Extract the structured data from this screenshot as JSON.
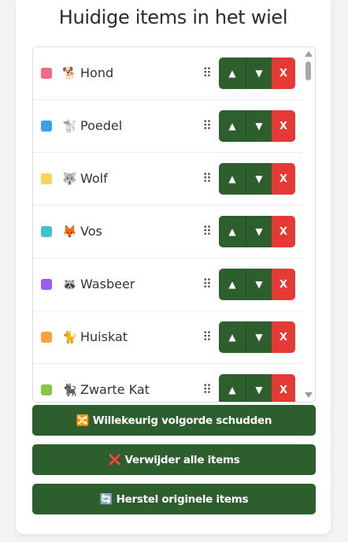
{
  "title": "Huidige items in het wiel",
  "items": [
    {
      "color": "#f06a86",
      "emoji": "🐕",
      "name": "Hond"
    },
    {
      "color": "#3aa0ea",
      "emoji": "🐩",
      "name": "Poedel"
    },
    {
      "color": "#ffd35a",
      "emoji": "🐺",
      "name": "Wolf"
    },
    {
      "color": "#3fc3c9",
      "emoji": "🦊",
      "name": "Vos"
    },
    {
      "color": "#9b5cf6",
      "emoji": "🦝",
      "name": "Wasbeer"
    },
    {
      "color": "#ff9f43",
      "emoji": "🐈",
      "name": "Huiskat"
    },
    {
      "color": "#8bc34a",
      "emoji": "🐈‍⬛",
      "name": "Zwarte Kat"
    }
  ],
  "item_controls": {
    "drag_handle": "⠿",
    "move_up": "▲",
    "move_down": "▼",
    "delete": "X"
  },
  "actions": {
    "shuffle": {
      "icon": "🔀",
      "label": "Willekeurig volgorde schudden"
    },
    "remove_all": {
      "icon": "❌",
      "label": "Verwijder alle items"
    },
    "restore": {
      "icon": "🔄",
      "label": "Herstel originele items"
    }
  },
  "colors": {
    "primary": "#2c5f2d",
    "danger": "#e53935"
  }
}
